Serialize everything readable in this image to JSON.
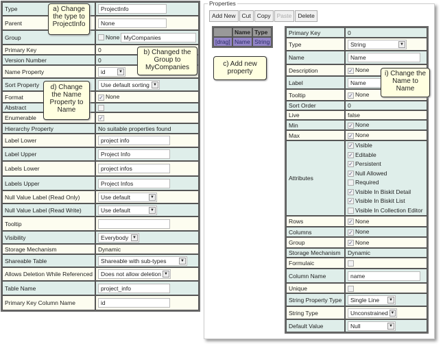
{
  "left_rows": [
    {
      "label": "Type",
      "kind": "input",
      "value": "ProjectInfo",
      "w": 100
    },
    {
      "label": "Parent",
      "kind": "input",
      "value": "None",
      "w": 100
    },
    {
      "label": "Group",
      "kind": "group",
      "none_label": "None",
      "value": "MyCompanies",
      "checked": false
    },
    {
      "label": "Primary Key",
      "kind": "text",
      "value": "0"
    },
    {
      "label": "Version Number",
      "kind": "text",
      "value": "0"
    },
    {
      "label": "Name Property",
      "kind": "select",
      "value": "id",
      "w": 40
    },
    {
      "label": "Sort Property",
      "kind": "select",
      "value": "Use default sorting",
      "w": 90
    },
    {
      "label": "Format",
      "kind": "checkNone",
      "value": "None",
      "checked": true
    },
    {
      "label": "Abstract",
      "kind": "check",
      "checked": false
    },
    {
      "label": "Enumerable",
      "kind": "check",
      "checked": true
    },
    {
      "label": "Hierarchy Property",
      "kind": "text",
      "value": "No suitable properties found"
    },
    {
      "label": "Label Lower",
      "kind": "input",
      "value": "project info",
      "w": 105
    },
    {
      "label": "Label Upper",
      "kind": "input",
      "value": "Project Info",
      "w": 105
    },
    {
      "label": "Labels Lower",
      "kind": "input",
      "value": "project infos",
      "w": 105
    },
    {
      "label": "Labels Upper",
      "kind": "input",
      "value": "Project Infos",
      "w": 105
    },
    {
      "label": "Null Value Label (Read Only)",
      "kind": "select",
      "value": "Use default",
      "w": 86
    },
    {
      "label": "Null Value Label (Read Write)",
      "kind": "select",
      "value": "Use default",
      "w": 86
    },
    {
      "label": "Tooltip",
      "kind": "input",
      "value": "",
      "w": 105
    },
    {
      "label": "Visibility",
      "kind": "select",
      "value": "Everybody",
      "w": 60
    },
    {
      "label": "Storage Mechanism",
      "kind": "text",
      "value": "Dynamic"
    },
    {
      "label": "Shareable Table",
      "kind": "select",
      "value": "Shareable with sub-types",
      "w": 130
    },
    {
      "label": "Allows Deletion While Referenced",
      "kind": "select",
      "value": "Does not allow deletion",
      "w": 106
    },
    {
      "label": "Table Name",
      "kind": "input",
      "value": "project_info",
      "w": 105
    },
    {
      "label": "Primary Key Column Name",
      "kind": "input",
      "value": "id",
      "w": 105
    }
  ],
  "properties": {
    "legend": "Properties",
    "buttons": [
      {
        "label": "Add New",
        "enabled": true
      },
      {
        "label": "Cut",
        "enabled": true
      },
      {
        "label": "Copy",
        "enabled": true
      },
      {
        "label": "Paste",
        "enabled": false
      },
      {
        "label": "Delete",
        "enabled": true
      }
    ],
    "list": {
      "headers": [
        "",
        "Name",
        "Type"
      ],
      "rows": [
        [
          "[drag]",
          "Name",
          "String"
        ]
      ]
    }
  },
  "right_rows": [
    {
      "label": "Primary Key",
      "kind": "text",
      "value": "0"
    },
    {
      "label": "Type",
      "kind": "select",
      "value": "String",
      "w": 86
    },
    {
      "label": "Name",
      "kind": "input",
      "value": "Name",
      "w": 106
    },
    {
      "label": "Description",
      "kind": "checkNone",
      "value": "None",
      "checked": true
    },
    {
      "label": "Label",
      "kind": "input",
      "value": "Name",
      "w": 106
    },
    {
      "label": "Tooltip",
      "kind": "checkNone",
      "value": "None",
      "checked": true
    },
    {
      "label": "Sort Order",
      "kind": "text",
      "value": "0"
    },
    {
      "label": "Live",
      "kind": "text",
      "value": "false"
    },
    {
      "label": "Min",
      "kind": "checkNone",
      "value": "None",
      "checked": true
    },
    {
      "label": "Max",
      "kind": "checkNone",
      "value": "None",
      "checked": true
    },
    {
      "label": "Attributes",
      "kind": "checks",
      "items": [
        {
          "label": "Visible",
          "checked": true
        },
        {
          "label": "Editable",
          "checked": true
        },
        {
          "label": "Persistent",
          "checked": true
        },
        {
          "label": "Null Allowed",
          "checked": true
        },
        {
          "label": "Required",
          "checked": false
        },
        {
          "label": "Visible In Biskit Detail",
          "checked": true
        },
        {
          "label": "Visible In Biskit List",
          "checked": true
        },
        {
          "label": "Visible In Collection Editor",
          "checked": false
        }
      ]
    },
    {
      "label": "Rows",
      "kind": "checkNone",
      "value": "None",
      "checked": true
    },
    {
      "label": "Columns",
      "kind": "checkNone",
      "value": "None",
      "checked": true
    },
    {
      "label": "Group",
      "kind": "checkNone",
      "value": "None",
      "checked": true
    },
    {
      "label": "Storage Mechanism",
      "kind": "text",
      "value": "Dynamic"
    },
    {
      "label": "Formulaic",
      "kind": "check",
      "checked": false
    },
    {
      "label": "Column Name",
      "kind": "input",
      "value": "name",
      "w": 106
    },
    {
      "label": "Unique",
      "kind": "check",
      "checked": false
    },
    {
      "label": "String Property Type",
      "kind": "select",
      "value": "Single Line",
      "w": 70
    },
    {
      "label": "String Type",
      "kind": "select",
      "value": "Unconstrained",
      "w": 72
    },
    {
      "label": "Default Value",
      "kind": "select",
      "value": "Null",
      "w": 70
    }
  ],
  "callouts": {
    "a": "a) Change the type to ProjectInfo",
    "b": "b) Changed the Group to MyCompanies",
    "c": "c) Add new property",
    "d": "d) Change the Name Property to Name",
    "i": "i) Change the Name to Name"
  }
}
